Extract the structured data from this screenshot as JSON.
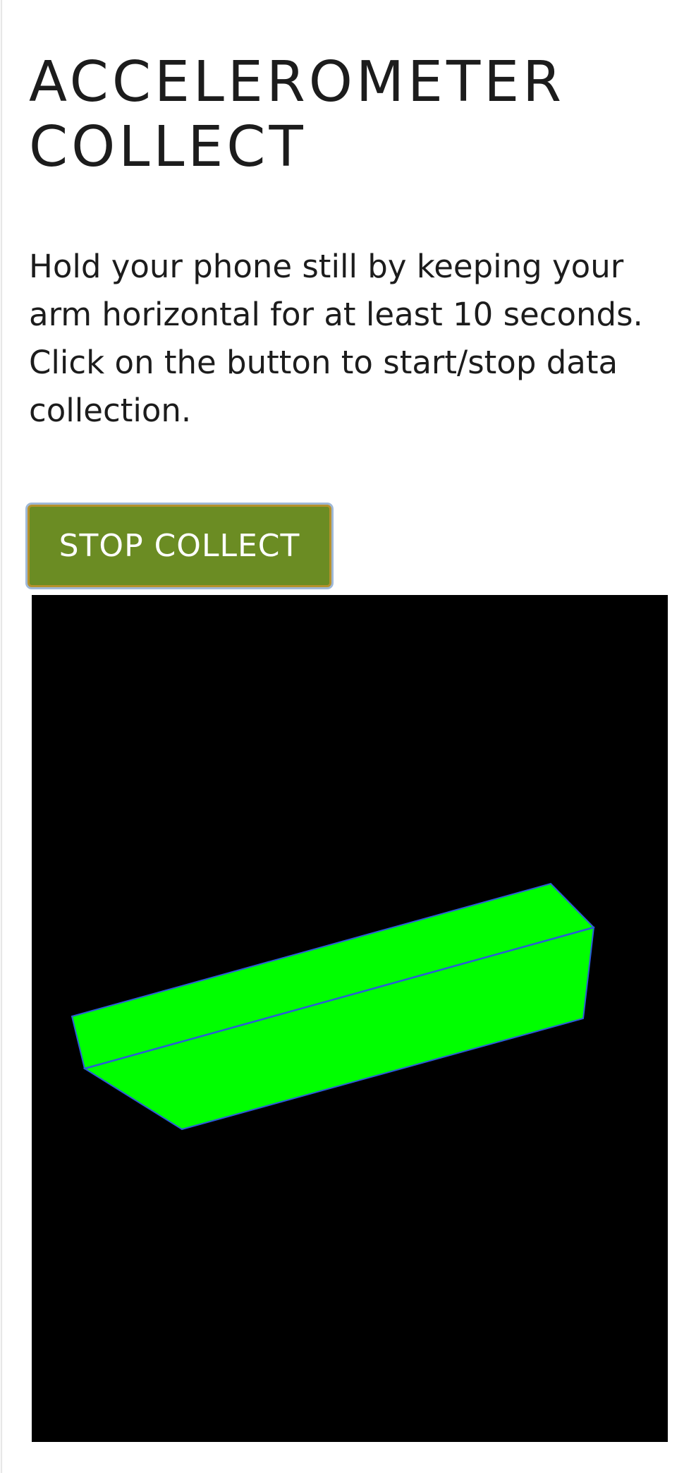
{
  "header": {
    "title_line1": "ACCELEROMETER",
    "title_line2": "COLLECT"
  },
  "main": {
    "instructions": "Hold your phone still by keeping your arm horizontal for at least 10 seconds. Click on the button to start/stop data collection.",
    "collect_button_label": "STOP COLLECT"
  },
  "viewer": {
    "background_color": "#000000",
    "object_color": "#00ff00",
    "edge_color": "#2b5bd7"
  },
  "colors": {
    "button_background": "#6b8c23",
    "button_border": "#b5912b",
    "text": "#1c1c1c"
  }
}
